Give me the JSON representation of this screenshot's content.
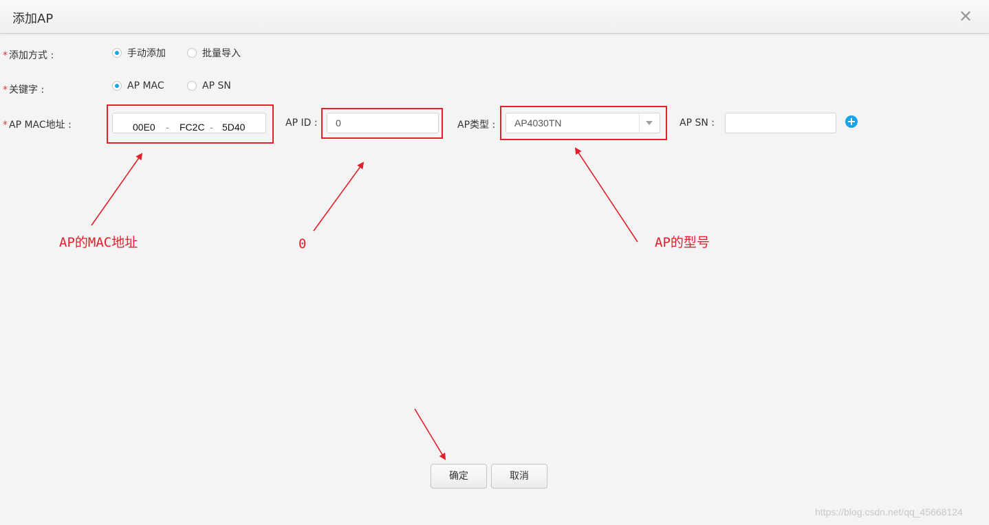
{
  "dialog": {
    "title": "添加AP",
    "close_glyph": "✕"
  },
  "form": {
    "add_method": {
      "label": "添加方式 :",
      "options": [
        "手动添加",
        "批量导入"
      ],
      "selected": "手动添加"
    },
    "keyword": {
      "label": "关键字 :",
      "options": [
        "AP MAC",
        "AP SN"
      ],
      "selected": "AP MAC"
    },
    "ap_mac": {
      "label": "AP MAC地址 :",
      "parts": [
        "00E0",
        "FC2C",
        "5D40"
      ],
      "separator": "-"
    },
    "ap_id": {
      "label": "AP ID :",
      "value": "0"
    },
    "ap_type": {
      "label": "AP类型 :",
      "value": "AP4030TN"
    },
    "ap_sn": {
      "label": "AP SN :",
      "value": ""
    },
    "required_mark": "*"
  },
  "annotations": {
    "mac": "AP的MAC地址",
    "id": "0",
    "type": "AP的型号"
  },
  "buttons": {
    "confirm": "确定",
    "cancel": "取消"
  },
  "watermark": "https://blog.csdn.net/qq_45668124",
  "colors": {
    "accent": "#1aa3e8",
    "annotation": "#e0202a",
    "required": "#ee3333"
  },
  "icons": {
    "close": "close-icon",
    "add": "plus-circle-icon",
    "dropdown": "chevron-down-icon"
  }
}
